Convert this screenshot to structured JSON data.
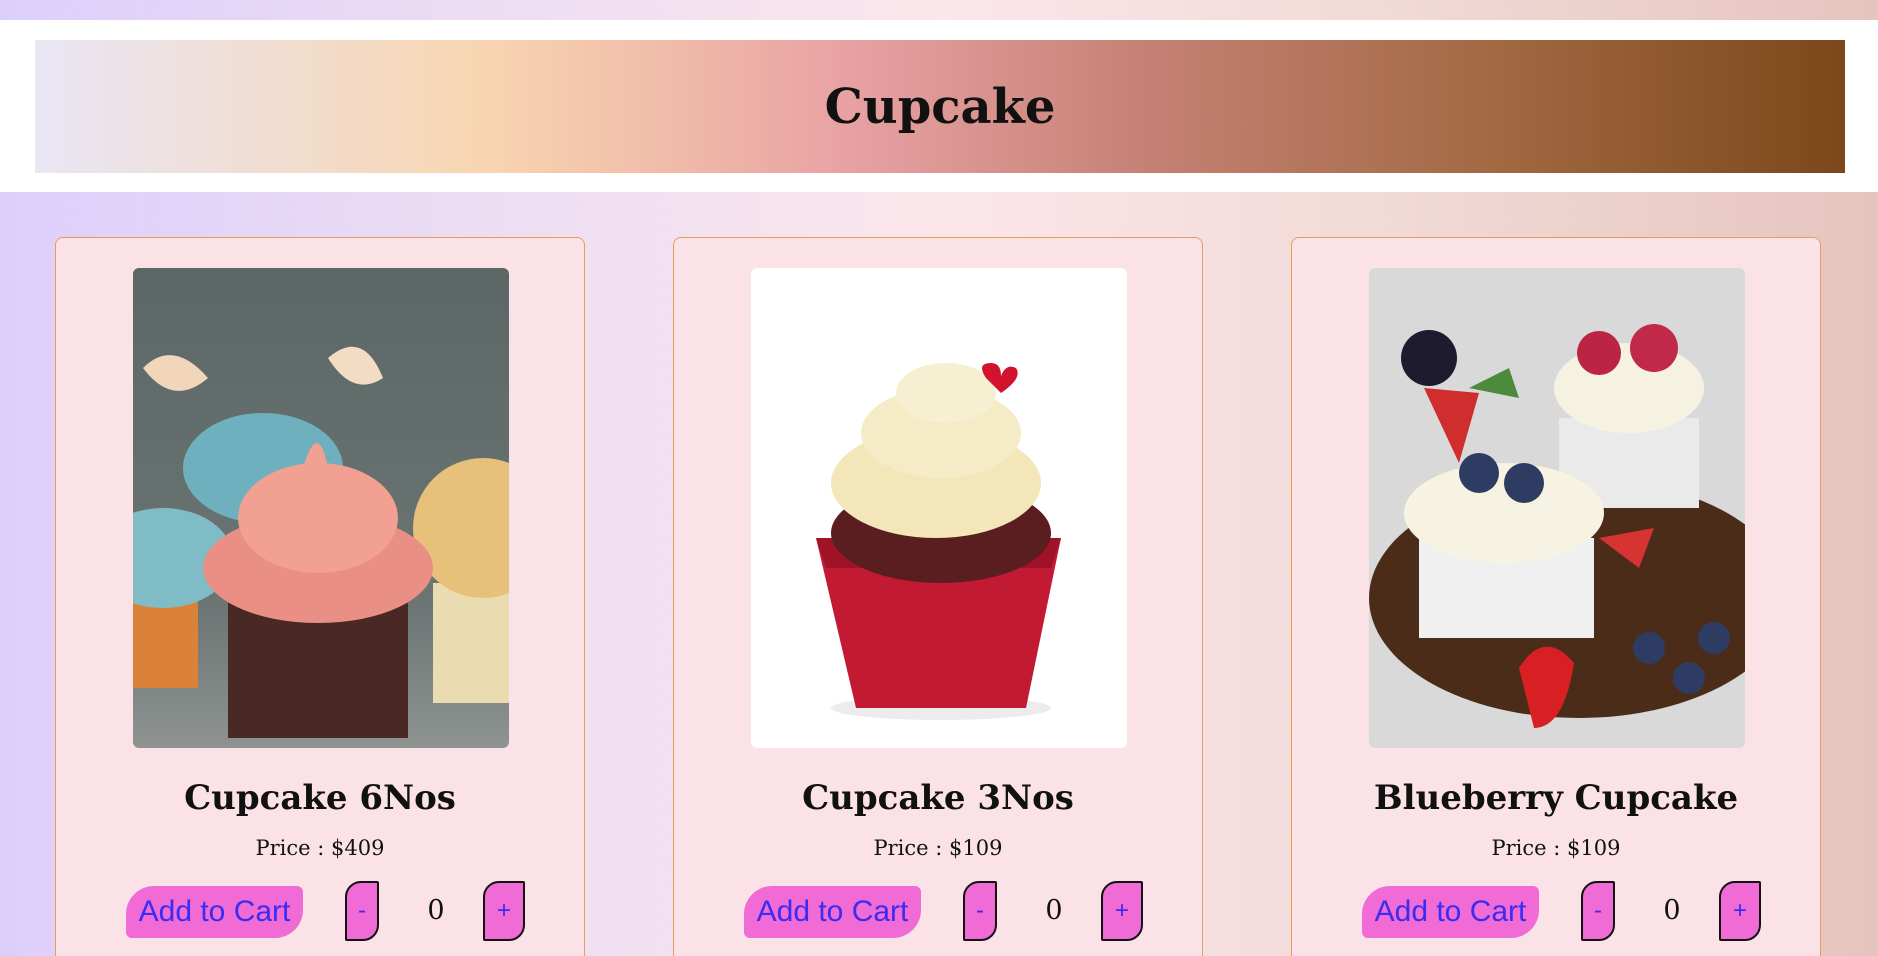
{
  "header": {
    "title": "Cupcake"
  },
  "products": [
    {
      "name": "Cupcake 6Nos",
      "price": "Price : $409",
      "add_label": "Add to Cart",
      "minus_label": "-",
      "plus_label": "+",
      "quantity": "0",
      "image_icon": "pastel-butterfly-cupcakes-image"
    },
    {
      "name": "Cupcake 3Nos",
      "price": "Price : $109",
      "add_label": "Add to Cart",
      "minus_label": "-",
      "plus_label": "+",
      "quantity": "0",
      "image_icon": "red-velvet-cupcake-image"
    },
    {
      "name": "Blueberry Cupcake",
      "price": "Price : $109",
      "add_label": "Add to Cart",
      "minus_label": "-",
      "plus_label": "+",
      "quantity": "0",
      "image_icon": "berry-cupcakes-image"
    }
  ],
  "colors": {
    "button_bg": "#f06bd5",
    "button_text": "#3a2cf0",
    "card_bg": "#fbe2e6",
    "card_border": "#e79c5a"
  }
}
